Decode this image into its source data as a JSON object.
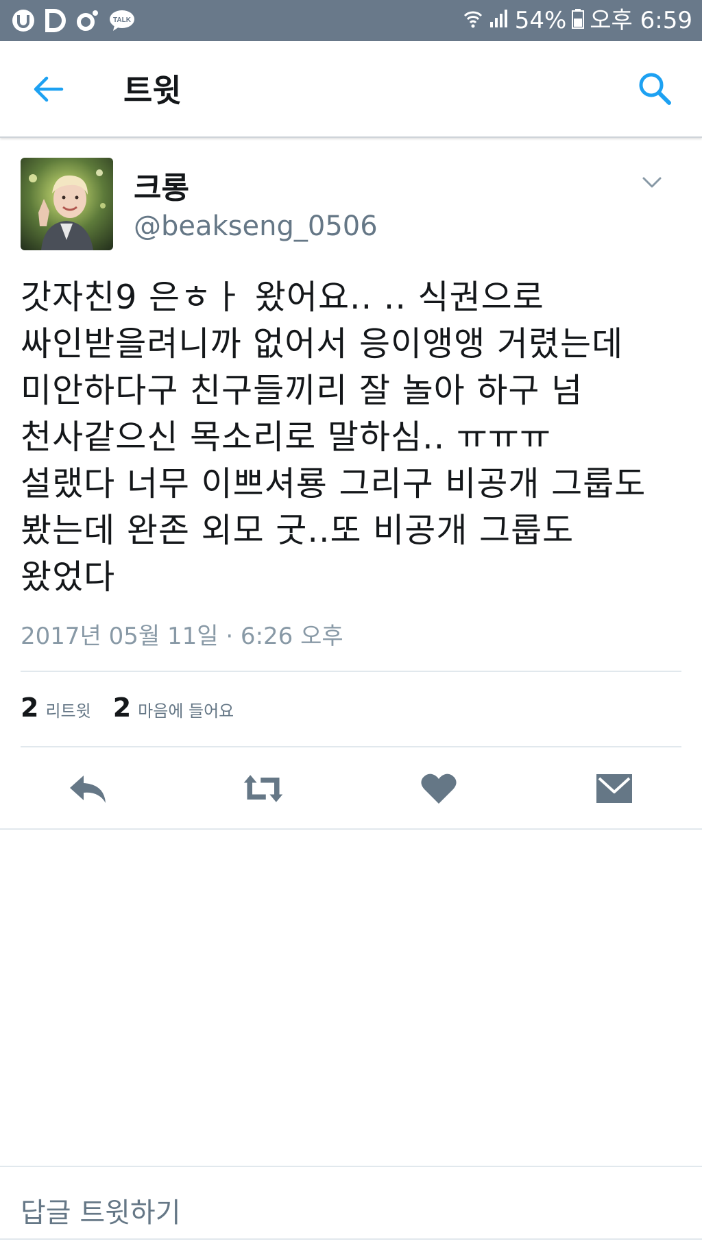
{
  "status_bar": {
    "left_icons": [
      "u-plus-icon",
      "d-icon",
      "o-icon",
      "kakaotalk-icon"
    ],
    "talk_label": "TALK",
    "battery_percent": "54%",
    "time": "오후 6:59"
  },
  "header": {
    "title": "트윗"
  },
  "tweet": {
    "author_name": "크롱",
    "author_handle": "@beakseng_0506",
    "text": "갓자친9 은ㅎㅏ 왔어요.. .. 식권으로\n싸인받을려니까 없어서 응이앵앵 거렸는데\n미안하다구 친구들끼리 잘 놀아 하구 넘\n천사같으신 목소리로 말하심..  ㅠㅠㅠ\n설랬다 너무 이쁘셔룡 그리구 비공개 그룹도\n봤는데 완존 외모 굿..또 비공개 그룹도\n왔었다",
    "timestamp": "2017년 05월 11일 · 6:26 오후",
    "retweet_count": "2",
    "retweet_label": "리트윗",
    "like_count": "2",
    "like_label": "마음에 들어요"
  },
  "reply": {
    "placeholder": "답글 트윗하기"
  },
  "colors": {
    "status_bar": "#69798a",
    "accent": "#1da1f2",
    "action_icon": "#657786",
    "secondary_text": "#657786"
  }
}
